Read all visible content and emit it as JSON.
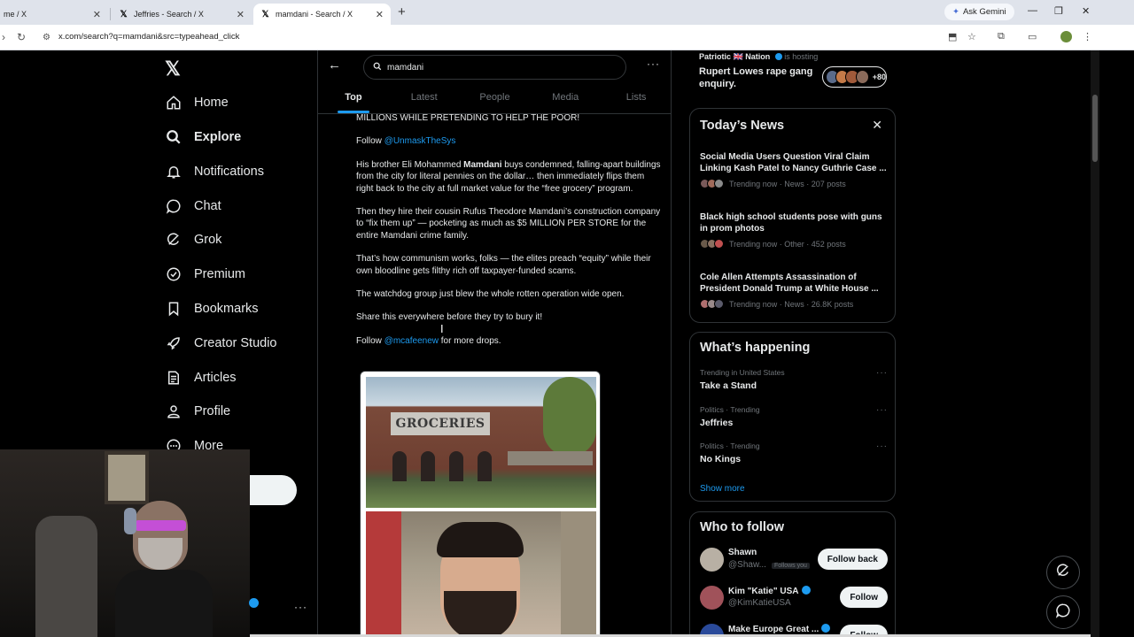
{
  "browser": {
    "tabs": [
      {
        "title": "me / X"
      },
      {
        "title": "Jeffries - Search / X"
      },
      {
        "title": "mamdani - Search / X"
      }
    ],
    "gemini": "Ask Gemini",
    "url": "x.com/search?q=mamdani&src=typeahead_click"
  },
  "nav": {
    "items": [
      {
        "label": "Home",
        "icon": "home-icon"
      },
      {
        "label": "Explore",
        "icon": "search-icon"
      },
      {
        "label": "Notifications",
        "icon": "bell-icon"
      },
      {
        "label": "Chat",
        "icon": "chat-icon"
      },
      {
        "label": "Grok",
        "icon": "grok-icon"
      },
      {
        "label": "Premium",
        "icon": "premium-icon"
      },
      {
        "label": "Bookmarks",
        "icon": "bookmark-icon"
      },
      {
        "label": "Creator Studio",
        "icon": "rocket-icon"
      },
      {
        "label": "Articles",
        "icon": "article-icon"
      },
      {
        "label": "Profile",
        "icon": "profile-icon"
      },
      {
        "label": "More",
        "icon": "more-icon"
      }
    ]
  },
  "search": {
    "query": "mamdani",
    "tabs": [
      "Top",
      "Latest",
      "People",
      "Media",
      "Lists"
    ],
    "active_tab": "Top"
  },
  "post": {
    "line0": "MILLIONS WHILE PRETENDING TO HELP THE POOR!",
    "follow1_prefix": "Follow ",
    "follow1_handle": "@UnmaskTheSys",
    "p2_a": "His brother Eli Mohammed ",
    "p2_b": "Mamdani",
    "p2_c": " buys condemned, falling-apart buildings from the city for literal pennies on the dollar… then immediately flips them right back to the city at full market value for the “free grocery” program.",
    "p3": "Then they hire their cousin Rufus Theodore Mamdani’s construction company to “fix them up” — pocketing as much as $5 MILLION PER STORE for the entire Mamdani crime family.",
    "p4": "That’s how communism works, folks — the elites preach “equity” while their own bloodline gets filthy rich off taxpayer-funded scams.",
    "p5": "The watchdog group just blew the whole rotten operation wide open.",
    "p6": "Share this everywhere before they try to bury it!",
    "follow2_prefix": "Follow ",
    "follow2_handle": "@mcafeenew",
    "follow2_suffix": " for more drops.",
    "image_sign": "GROCERIES"
  },
  "space": {
    "host_name": "Patriotic 🇬🇧 Nation",
    "host_suffix": "is hosting",
    "title": "Rupert Lowes rape gang enquiry.",
    "listeners": "+80"
  },
  "news": {
    "heading": "Today’s News",
    "items": [
      {
        "headline": "Social Media Users Question Viral Claim Linking Kash Patel to Nancy Guthrie Case ...",
        "meta": "Trending now · News · 207 posts"
      },
      {
        "headline": "Black high school students pose with guns in prom photos",
        "meta": "Trending now · Other · 452 posts"
      },
      {
        "headline": "Cole Allen Attempts Assassination of President Donald Trump at White House ...",
        "meta": "Trending now · News · 26.8K posts"
      }
    ]
  },
  "happening": {
    "heading": "What’s happening",
    "items": [
      {
        "context": "Trending in United States",
        "name": "Take a Stand"
      },
      {
        "context": "Politics · Trending",
        "name": "Jeffries"
      },
      {
        "context": "Politics · Trending",
        "name": "No Kings"
      }
    ],
    "show_more": "Show more"
  },
  "who_to_follow": {
    "heading": "Who to follow",
    "items": [
      {
        "name": "Shawn",
        "handle": "@Shaw...",
        "badge": "Follows you",
        "button": "Follow back"
      },
      {
        "name": "Kim \"Katie\" USA",
        "handle": "@KimKatieUSA",
        "button": "Follow"
      },
      {
        "name": "Make Europe Great ...",
        "handle": "",
        "button": "Follow"
      }
    ]
  },
  "colors": {
    "accent": "#1d9bf0",
    "background": "#000000",
    "border": "#2f3336",
    "muted": "#71767b"
  }
}
